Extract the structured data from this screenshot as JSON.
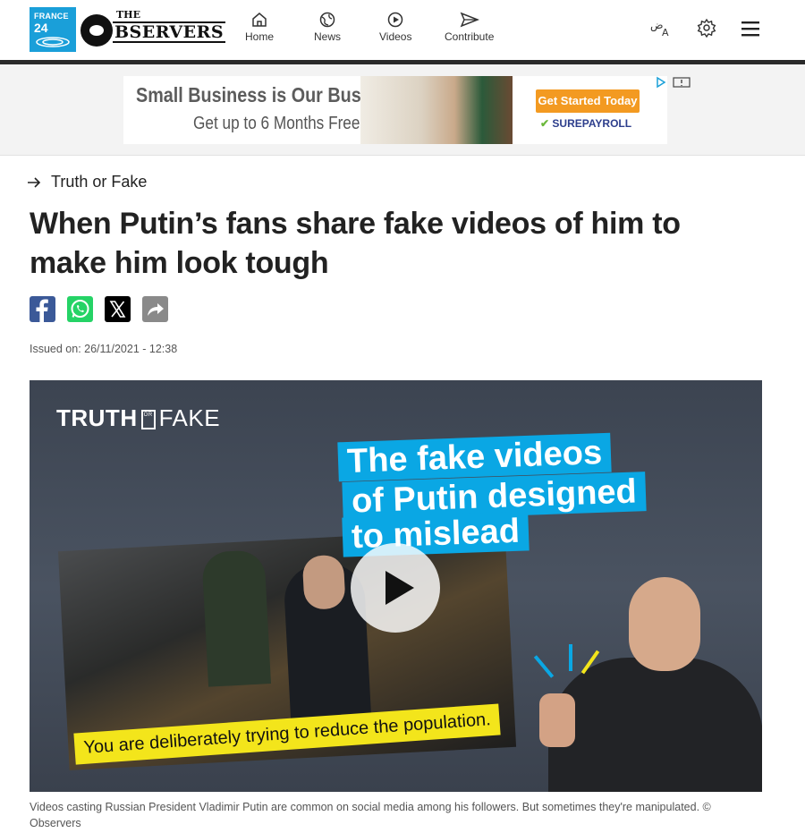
{
  "header": {
    "brand_small": "FRANCE",
    "brand_num": "24",
    "observers_the": "THE",
    "observers_name": "BSERVERS",
    "nav": [
      {
        "label": "Home",
        "icon": "home-icon"
      },
      {
        "label": "News",
        "icon": "globe-icon"
      },
      {
        "label": "Videos",
        "icon": "play-circle-icon"
      },
      {
        "label": "Contribute",
        "icon": "send-icon"
      }
    ],
    "right_icons": [
      "language-icon",
      "gear-icon",
      "hamburger-menu-icon"
    ]
  },
  "ad": {
    "title": "Small Business is Our Business",
    "subtitle": "Get up to 6 Months Free",
    "cta": "Get Started Today",
    "brand_check": "✔",
    "brand": "SUREPAYROLL",
    "icons": [
      "adchoices-icon",
      "close-ad-icon"
    ]
  },
  "article": {
    "section": "Truth or Fake",
    "headline": "When Putin’s fans share fake videos of him to make him look tough",
    "share": [
      {
        "name": "facebook-share-icon",
        "color": "#3b5998"
      },
      {
        "name": "whatsapp-share-icon",
        "color": "#25d366"
      },
      {
        "name": "x-share-icon",
        "color": "#000000"
      },
      {
        "name": "share-icon",
        "color": "#8a8a8a"
      }
    ],
    "issued": "Issued on: 26/11/2021 - 12:38"
  },
  "video": {
    "brand_truth": "TRUTH",
    "brand_or": "OR",
    "brand_fake": "FAKE",
    "caption_lines": [
      "The fake videos",
      "of Putin designed",
      "to mislead"
    ],
    "subtitle": "You are deliberately trying to reduce the population.",
    "caption": "Videos casting Russian President Vladimir Putin are common on social media among his followers. But sometimes they're manipulated. © Observers"
  },
  "colors": {
    "f24_blue": "#1a9fd9",
    "caption_blue": "#0aa7e4",
    "subtitle_yellow": "#f3e51b",
    "cta_orange": "#f39a21"
  }
}
